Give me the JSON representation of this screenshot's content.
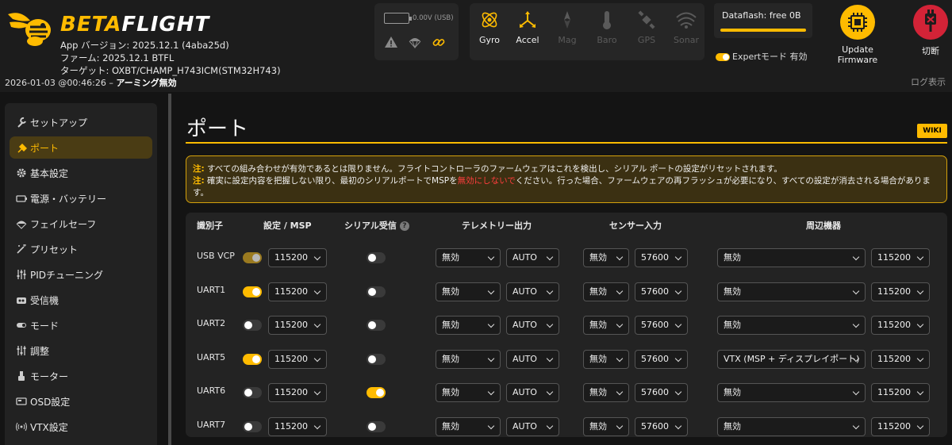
{
  "header": {
    "brand_part1": "BETA",
    "brand_part2": "FLIGHT",
    "app_version": "App バージョン: 2025.12.1 (4aba25d)",
    "firmware": "ファーム: 2025.12.1 BTFL",
    "target": "ターゲット: OXBT/CHAMP_H743ICM(STM32H743)",
    "datetime": "2026-01-03 @00:46:26 – ",
    "arming_status": "アーミング無効",
    "battery_text": "0.00V (USB)",
    "sensors": [
      {
        "label": "Gyro",
        "icon": "gyro-icon",
        "active": true
      },
      {
        "label": "Accel",
        "icon": "accel-icon",
        "active": true
      },
      {
        "label": "Mag",
        "icon": "mag-icon",
        "active": false
      },
      {
        "label": "Baro",
        "icon": "baro-icon",
        "active": false
      },
      {
        "label": "GPS",
        "icon": "gps-icon",
        "active": false
      },
      {
        "label": "Sonar",
        "icon": "sonar-icon",
        "active": false
      }
    ],
    "dataflash": "Dataflash: free 0B",
    "expert_mode": "Expertモード 有効",
    "update_firmware": "Update Firmware",
    "disconnect": "切断",
    "show_log": "ログ表示"
  },
  "sidebar": {
    "items": [
      {
        "label": "セットアップ",
        "icon": "wrench-icon",
        "active": false
      },
      {
        "label": "ポート",
        "icon": "plug-icon",
        "active": true
      },
      {
        "label": "基本設定",
        "icon": "gear-icon",
        "active": false
      },
      {
        "label": "電源・バッテリー",
        "icon": "battery-icon",
        "active": false
      },
      {
        "label": "フェイルセーフ",
        "icon": "parachute-icon",
        "active": false
      },
      {
        "label": "プリセット",
        "icon": "wand-icon",
        "active": false
      },
      {
        "label": "PIDチューニング",
        "icon": "sliders-icon",
        "active": false
      },
      {
        "label": "受信機",
        "icon": "receiver-icon",
        "active": false
      },
      {
        "label": "モード",
        "icon": "switch-icon",
        "active": false
      },
      {
        "label": "調整",
        "icon": "adjust-icon",
        "active": false
      },
      {
        "label": "モーター",
        "icon": "motor-icon",
        "active": false
      },
      {
        "label": "OSD設定",
        "icon": "osd-icon",
        "active": false
      },
      {
        "label": "VTX設定",
        "icon": "vtx-icon",
        "active": false
      }
    ]
  },
  "main": {
    "title": "ポート",
    "wiki": "WIKI",
    "note1_label": "注:",
    "note1_text": " すべての組み合わせが有効であるとは限りません。フライトコントローラのファームウェアはこれを検出し、シリアル ポートの設定がリセットされます。",
    "note2_label": "注:",
    "note2_text_a": " 確実に設定内容を把握しない限り、最初のシリアルポートでMSPを",
    "note2_text_red": "無効にしないで",
    "note2_text_b": "ください。行った場合、ファームウェアの再フラッシュが必要になり、すべての設定が消去される場合があります。",
    "columns": {
      "identifier": "識別子",
      "config_msp": "設定 / MSP",
      "serial_rx": "シリアル受信",
      "telemetry": "テレメトリー出力",
      "sensor": "センサー入力",
      "peripherals": "周辺機器"
    },
    "ports": [
      {
        "id": "USB VCP",
        "msp": "locked",
        "msp_baud": "115200",
        "serial_rx": false,
        "telem": "無効",
        "telem_baud": "AUTO",
        "sensor": "無効",
        "sensor_baud": "57600",
        "periph": "無効",
        "periph_baud": "115200"
      },
      {
        "id": "UART1",
        "msp": "on",
        "msp_baud": "115200",
        "serial_rx": false,
        "telem": "無効",
        "telem_baud": "AUTO",
        "sensor": "無効",
        "sensor_baud": "57600",
        "periph": "無効",
        "periph_baud": "115200"
      },
      {
        "id": "UART2",
        "msp": "off",
        "msp_baud": "115200",
        "serial_rx": false,
        "telem": "無効",
        "telem_baud": "AUTO",
        "sensor": "無効",
        "sensor_baud": "57600",
        "periph": "無効",
        "periph_baud": "115200"
      },
      {
        "id": "UART5",
        "msp": "on",
        "msp_baud": "115200",
        "serial_rx": false,
        "telem": "無効",
        "telem_baud": "AUTO",
        "sensor": "無効",
        "sensor_baud": "57600",
        "periph": "VTX (MSP + ディスプレイポート)",
        "periph_baud": "115200"
      },
      {
        "id": "UART6",
        "msp": "off",
        "msp_baud": "115200",
        "serial_rx": true,
        "telem": "無効",
        "telem_baud": "AUTO",
        "sensor": "無効",
        "sensor_baud": "57600",
        "periph": "無効",
        "periph_baud": "115200"
      },
      {
        "id": "UART7",
        "msp": "off",
        "msp_baud": "115200",
        "serial_rx": false,
        "telem": "無効",
        "telem_baud": "AUTO",
        "sensor": "無効",
        "sensor_baud": "57600",
        "periph": "無効",
        "periph_baud": "115200"
      }
    ]
  },
  "colors": {
    "accent": "#ffbb00",
    "danger": "#d32337",
    "warning_text": "#ff3d3d"
  }
}
